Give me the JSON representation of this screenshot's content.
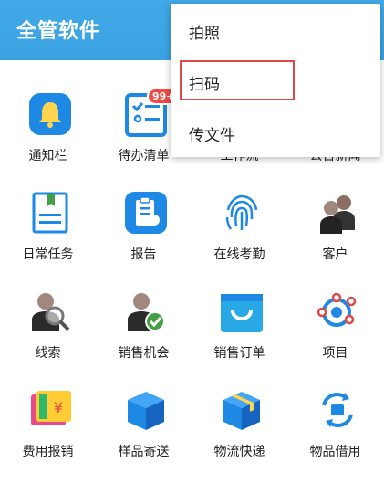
{
  "header": {
    "title": "全管软件"
  },
  "grid": {
    "row1": [
      "通知栏",
      "待办清单",
      "工作流",
      "公告新闻"
    ],
    "row2": [
      "日常任务",
      "报告",
      "在线考勤",
      "客户"
    ],
    "row3": [
      "线索",
      "销售机会",
      "销售订单",
      "项目"
    ],
    "row4": [
      "费用报销",
      "样品寄送",
      "物流快递",
      "物品借用"
    ],
    "badge": "99+"
  },
  "menu": {
    "items": [
      "拍照",
      "扫码",
      "传文件"
    ]
  },
  "colors": {
    "header": "#3aa2e2",
    "accent": "#e04848"
  }
}
